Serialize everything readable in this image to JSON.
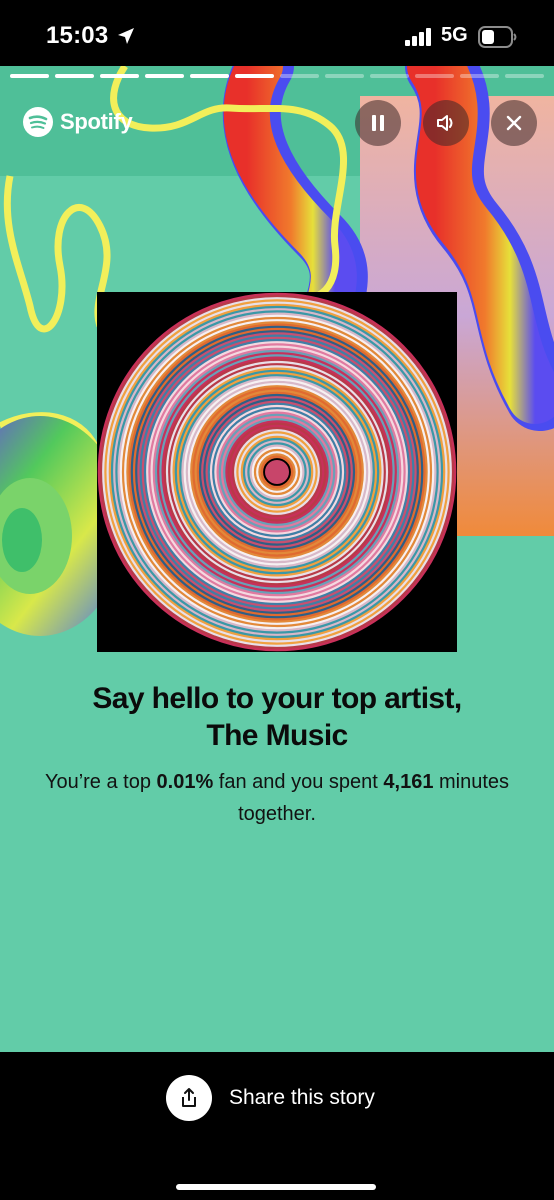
{
  "status_bar": {
    "time": "15:03",
    "network": "5G",
    "icons": [
      "location-arrow-icon",
      "signal-bars-icon",
      "battery-icon"
    ]
  },
  "story": {
    "progress": {
      "segments": 12,
      "completed": 6
    },
    "brand": {
      "name": "Spotify",
      "icon": "spotify-logo-icon"
    },
    "controls": {
      "pause_icon": "pause-icon",
      "volume_icon": "speaker-icon",
      "close_icon": "close-icon"
    },
    "headline_line1": "Say hello to your top artist,",
    "headline_line2": "The Music",
    "sub": {
      "part1": "You’re a top ",
      "percent": "0.01%",
      "part2": " fan and you spent ",
      "minutes": "4,161",
      "part3": " minutes together."
    },
    "colors": {
      "background": "#62cca8",
      "text": "#0b0b0b",
      "accent_yellow": "#f2ef5a"
    }
  },
  "share": {
    "label": "Share this story",
    "icon": "share-upload-icon"
  }
}
